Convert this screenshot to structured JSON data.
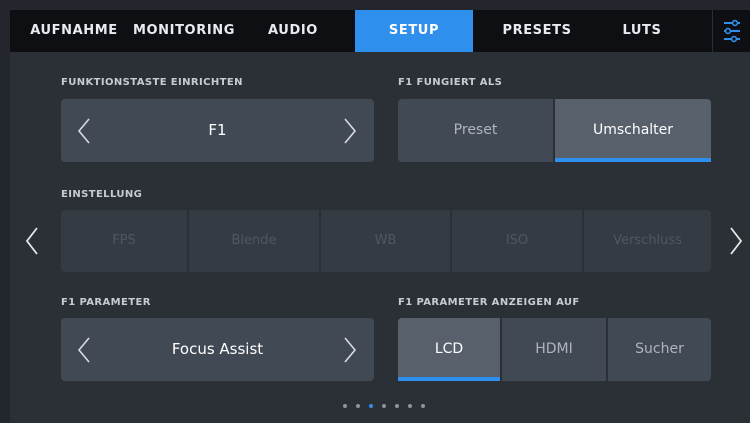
{
  "tabs": [
    {
      "label": "AUFNAHME"
    },
    {
      "label": "MONITORING"
    },
    {
      "label": "AUDIO"
    },
    {
      "label": "SETUP"
    },
    {
      "label": "PRESETS"
    },
    {
      "label": "LUTS"
    }
  ],
  "active_tab": "SETUP",
  "function_key": {
    "label": "FUNKTIONSTASTE EINRICHTEN",
    "value": "F1"
  },
  "f1_mode": {
    "label": "F1 FUNGIERT ALS",
    "options": [
      "Preset",
      "Umschalter"
    ],
    "selected": "Umschalter"
  },
  "setting": {
    "label": "EINSTELLUNG",
    "options": [
      "FPS",
      "Blende",
      "WB",
      "ISO",
      "Verschluss"
    ]
  },
  "f1_parameter": {
    "label": "F1 PARAMETER",
    "value": "Focus Assist"
  },
  "f1_display": {
    "label": "F1 PARAMETER ANZEIGEN AUF",
    "options": [
      "LCD",
      "HDMI",
      "Sucher"
    ],
    "selected": "LCD"
  },
  "pagination": {
    "total": 7,
    "current": 3
  },
  "colors": {
    "accent": "#2f8fec",
    "background": "#2b3037",
    "box": "#414954"
  }
}
